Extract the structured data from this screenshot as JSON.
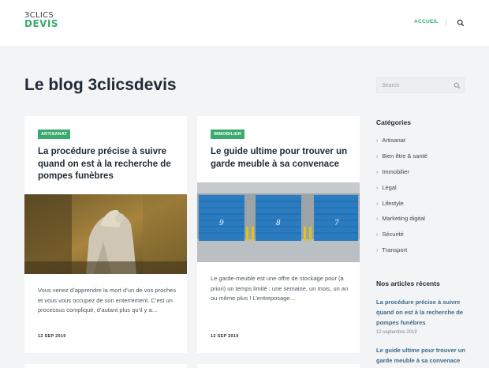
{
  "header": {
    "logo_line1": "3CLICS",
    "logo_line2": "DEVIS",
    "nav_home": "ACCUEIL",
    "search_icon": "search-icon"
  },
  "page_title": "Le blog 3clicsdevis",
  "posts": [
    {
      "category": "ARTISANAT",
      "title": "La procédure précise à suivre quand on est à la recherche de pompes funèbres",
      "image": "cemetery-angel-statue-photo",
      "excerpt": "Vous venez d’apprendre la mort d’un de vos proches et vous vous occupez de son enterrement. C’est un processus compliqué, d’autant plus qu’il y a…",
      "date": "12 SEP 2019"
    },
    {
      "category": "IMMOBILIER",
      "title": "Le guide ultime pour trouver un garde meuble à sa convenace",
      "image": "blue-storage-garage-doors-photo",
      "door_numbers": [
        "9",
        "8",
        "7"
      ],
      "excerpt": "Le garde-meuble est une offre de stockage pour (a priori) un temps limité : une semaine, un mois, un an ou même plus ! L’entreposage…",
      "date": "12 SEP 2019"
    }
  ],
  "sidebar": {
    "search_placeholder": "Search",
    "categories_heading": "Catégories",
    "categories": [
      "Artisanat",
      "Bien être & santé",
      "Immobilier",
      "Légal",
      "Lifestyle",
      "Marketing digital",
      "Sécurité",
      "Transport"
    ],
    "recent_heading": "Nos articles récents",
    "recent": [
      {
        "title": "La procédure précise à suivre quand on est à la recherche de pompes funèbres",
        "date": "12 septembre 2019"
      },
      {
        "title": "Le guide ultime pour trouver un garde meuble à sa convenace",
        "date": ""
      }
    ]
  },
  "colors": {
    "accent": "#3aaa6e",
    "link": "#3a6b8c",
    "background": "#f3f4f6",
    "door_blue": "#2a7bc0"
  }
}
